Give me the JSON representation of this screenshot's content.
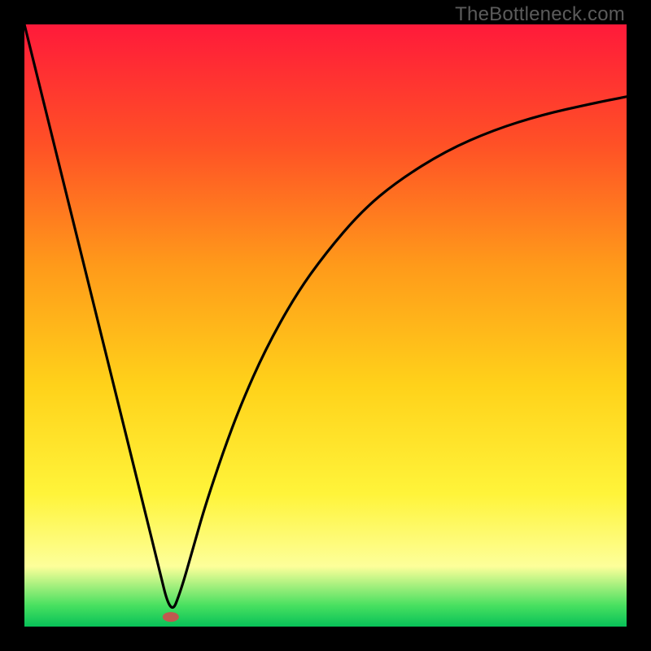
{
  "watermark": "TheBottleneck.com",
  "chart_data": {
    "type": "line",
    "title": "",
    "xlabel": "",
    "ylabel": "",
    "xlim": [
      0,
      100
    ],
    "ylim": [
      0,
      100
    ],
    "grid": false,
    "legend": false,
    "gradient_stops": [
      {
        "offset": 0.0,
        "color": "#ff1a3a"
      },
      {
        "offset": 0.2,
        "color": "#ff5126"
      },
      {
        "offset": 0.4,
        "color": "#ff9a1a"
      },
      {
        "offset": 0.6,
        "color": "#ffd21a"
      },
      {
        "offset": 0.78,
        "color": "#fff43a"
      },
      {
        "offset": 0.9,
        "color": "#fdff9a"
      },
      {
        "offset": 0.965,
        "color": "#48e060"
      },
      {
        "offset": 1.0,
        "color": "#07c158"
      }
    ],
    "marker": {
      "x": 24.3,
      "y": 1.6,
      "color": "#c0594f"
    },
    "series": [
      {
        "name": "curve",
        "color": "#000000",
        "x": [
          0,
          5,
          10,
          15,
          20,
          22,
          24.3,
          26,
          28,
          30,
          33,
          36,
          40,
          45,
          50,
          56,
          62,
          70,
          78,
          86,
          94,
          100
        ],
        "values": [
          100,
          79.8,
          59.6,
          39.4,
          19.2,
          11.1,
          1.7,
          6.0,
          13.0,
          20.0,
          29.0,
          37.0,
          46.0,
          55.0,
          62.0,
          69.0,
          74.0,
          79.0,
          82.5,
          85.0,
          86.8,
          88.0
        ]
      }
    ]
  }
}
